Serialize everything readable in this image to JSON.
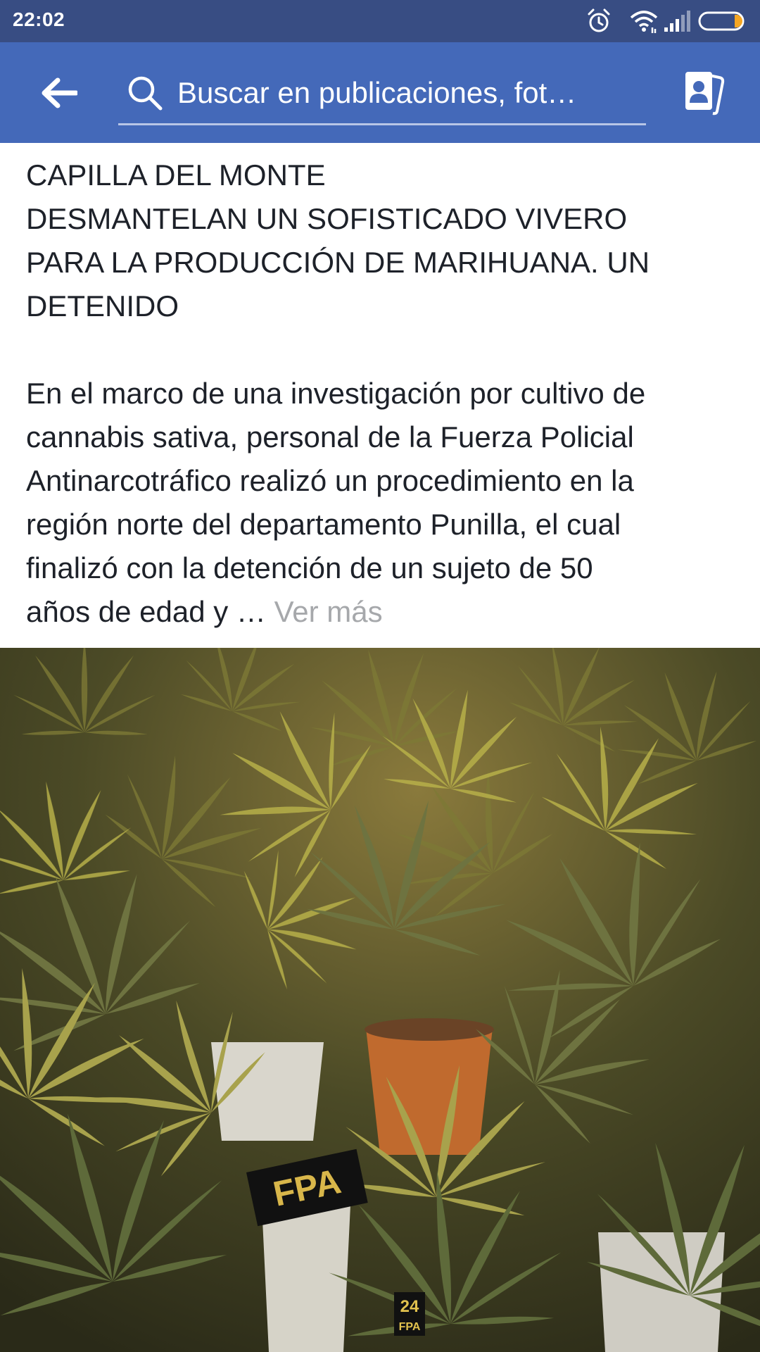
{
  "status_bar": {
    "time": "22:02",
    "icons": [
      "alarm-icon",
      "wifi-icon",
      "signal-icon",
      "battery-icon"
    ]
  },
  "app_bar": {
    "back_icon": "arrow-left-icon",
    "search_placeholder": "Buscar en publicaciones, fot…",
    "search_icon": "search-icon",
    "contacts_icon": "contacts-icon"
  },
  "post": {
    "headline": [
      "CAPILLA DEL MONTE",
      "DESMANTELAN UN SOFISTICADO VIVERO",
      "PARA LA PRODUCCIÓN DE MARIHUANA. UN",
      "DETENIDO"
    ],
    "body": [
      "En el marco de una investigación por cultivo de",
      "cannabis sativa, personal de la Fuerza Policial",
      "Antinarcotráfico realizó un procedimiento en la",
      "región norte del departamento Punilla, el cual",
      "finalizó con la detención de un sujeto de 50"
    ],
    "body_last": "años de edad y … ",
    "see_more": "Ver más",
    "photo": {
      "sign_text": "FPA",
      "tag_number": "24",
      "tag_text": "FPA"
    }
  },
  "colors": {
    "status_bar": "#384d83",
    "app_bar": "#4469b9",
    "text": "#1d2129",
    "see_more": "#a6a8ab"
  }
}
